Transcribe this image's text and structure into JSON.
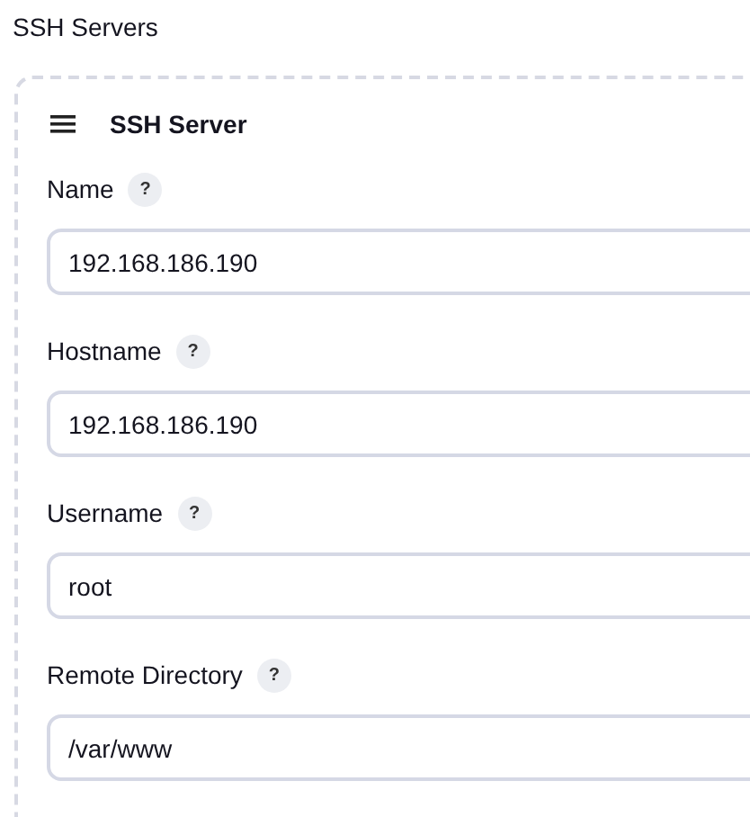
{
  "section_title": "SSH Servers",
  "card": {
    "title": "SSH Server",
    "fields": [
      {
        "label": "Name",
        "help": "?",
        "value": "192.168.186.190"
      },
      {
        "label": "Hostname",
        "help": "?",
        "value": "192.168.186.190"
      },
      {
        "label": "Username",
        "help": "?",
        "value": "root"
      },
      {
        "label": "Remote Directory",
        "help": "?",
        "value": "/var/www"
      }
    ]
  }
}
